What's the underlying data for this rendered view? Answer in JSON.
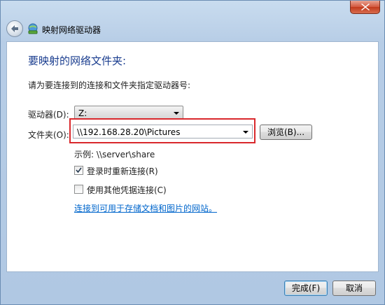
{
  "window": {
    "title": "映射网络驱动器"
  },
  "dialog": {
    "heading": "要映射的网络文件夹:",
    "instruction": "请为要连接到的连接和文件夹指定驱动器号:",
    "drive": {
      "label": "驱动器(D):",
      "value": "Z:"
    },
    "folder": {
      "label": "文件夹(O):",
      "value": "\\\\192.168.28.20\\Pictures",
      "browse_label": "浏览(B)..."
    },
    "example_text": "示例: \\\\server\\share",
    "reconnect": {
      "label": "登录时重新连接(R)",
      "checked": true
    },
    "other_credentials": {
      "label": "使用其他凭据连接(C)",
      "checked": false
    },
    "link_text": "连接到可用于存储文档和图片的网站。",
    "highlight_color": "#d9282c"
  },
  "footer": {
    "finish_label": "完成(F)",
    "cancel_label": "取消"
  }
}
